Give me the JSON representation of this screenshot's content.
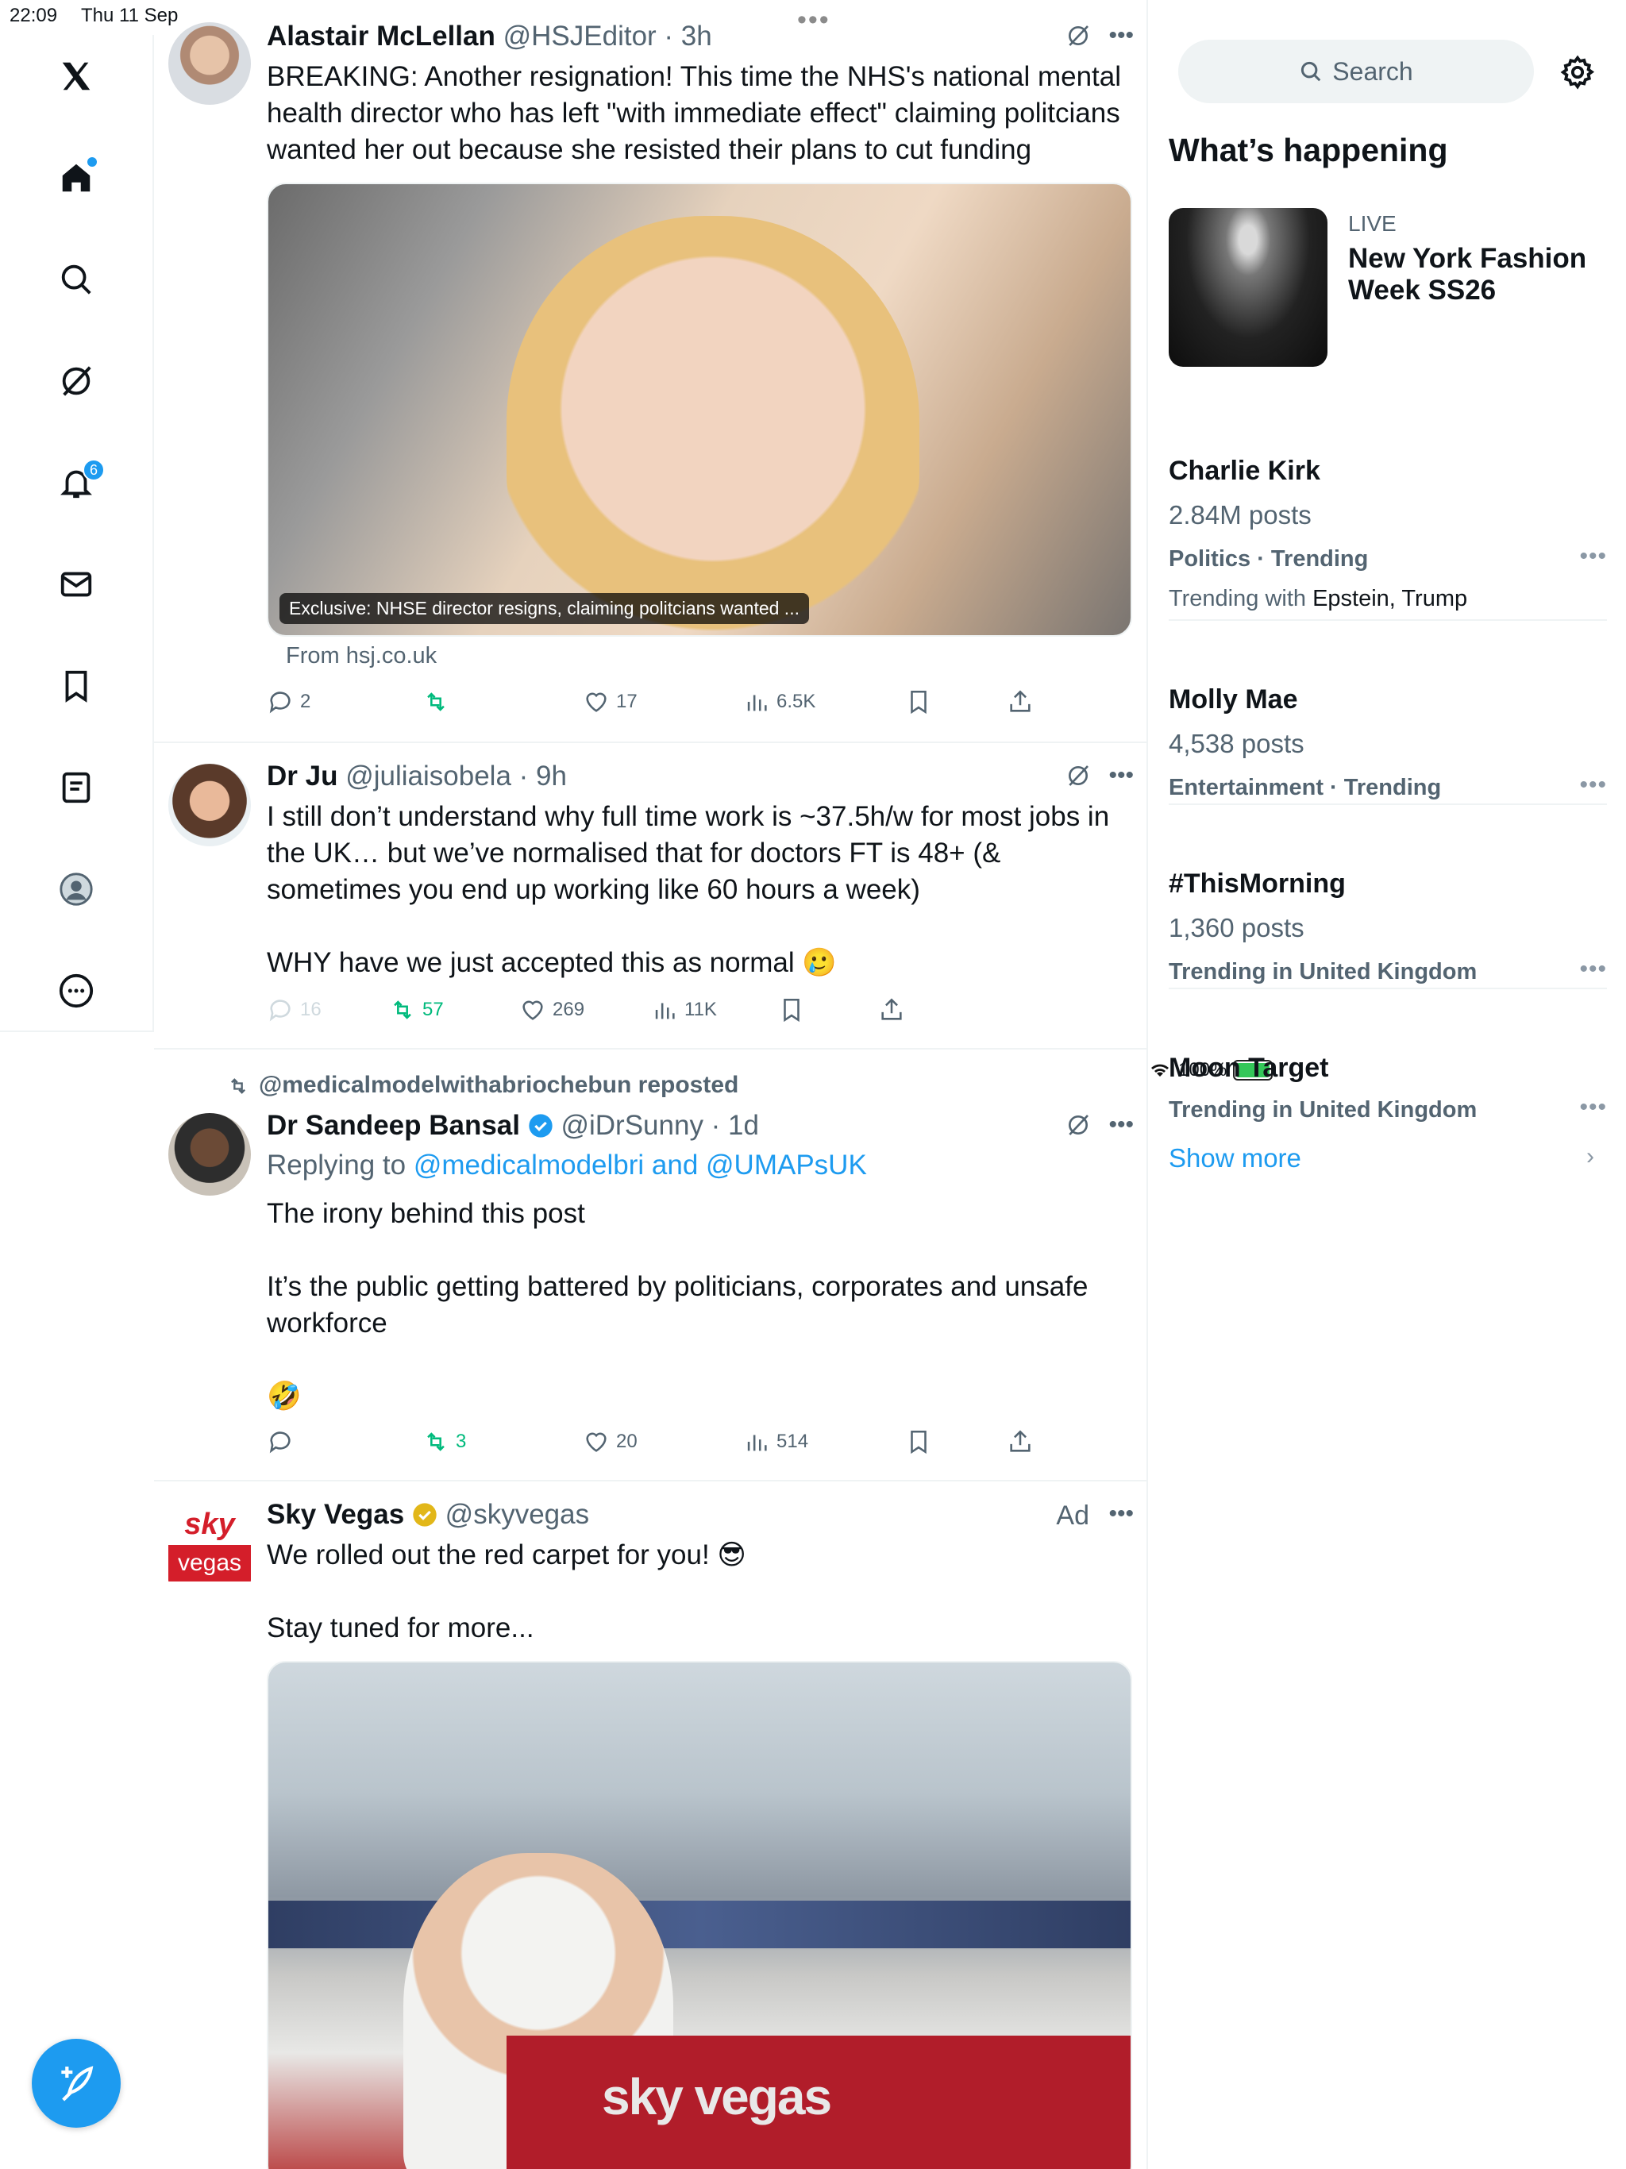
{
  "status_bar": {
    "time": "22:09",
    "date": "Thu 11 Sep",
    "battery": "100%"
  },
  "nav": {
    "items": [
      "x-logo",
      "home",
      "search",
      "grok",
      "notifications",
      "messages",
      "bookmarks",
      "lists",
      "profile",
      "more"
    ],
    "notification_count": "6"
  },
  "tweets": [
    {
      "name": "Alastair McLellan",
      "handle": "@HSJEditor · 3h",
      "text": "BREAKING: Another resignation! This time the NHS's national mental health director who has left \"with immediate effect\" claiming politcians wanted her out because she resisted their plans to cut funding",
      "media_caption": "Exclusive: NHSE director resigns, claiming politcians wanted ...",
      "from": "From hsj.co.uk",
      "replies": "2",
      "reposts": "",
      "likes": "17",
      "views": "6.5K"
    },
    {
      "name": "Dr Ju",
      "handle": "@juliaisobela · 9h",
      "text": "I still don’t understand why full time work is ~37.5h/w for most jobs in the UK… but we’ve normalised that for doctors FT is 48+ (& sometimes you end up working like 60 hours a week)\n\nWHY have we just accepted this as normal 🥲",
      "replies": "16",
      "reposts": "57",
      "likes": "269",
      "views": "11K"
    },
    {
      "repost_by": "@medicalmodelwithabriochebun reposted",
      "name": "Dr Sandeep Bansal",
      "handle": "@iDrSunny · 1d",
      "replying_prefix": "Replying to ",
      "replying_to": "@medicalmodelbri and @UMAPsUK",
      "text": "The irony behind this post\n\nIt’s the public getting battered by politicians, corporates and unsafe workforce\n\n🤣",
      "replies": "",
      "reposts": "3",
      "likes": "20",
      "views": "514"
    },
    {
      "name": "Sky Vegas",
      "handle": "@skyvegas",
      "ad": "Ad",
      "text": "We rolled out the red carpet for you! 😎\n\nStay tuned for more...",
      "logo_top": "sky",
      "logo_bottom": "vegas",
      "media_brand": "sky vegas"
    }
  ],
  "right": {
    "search_placeholder": "Search",
    "section_title": "What’s happening",
    "event": {
      "live": "LIVE",
      "title": "New York Fashion Week SS26"
    },
    "trends": [
      {
        "name": "Charlie Kirk",
        "posts": "2.84M posts",
        "category": "Politics · Trending",
        "with_prefix": "Trending with ",
        "with": "Epstein, Trump"
      },
      {
        "name": "Molly Mae",
        "posts": "4,538 posts",
        "category": "Entertainment · Trending"
      },
      {
        "name": "#ThisMorning",
        "posts": "1,360 posts",
        "category": "Trending in United Kingdom"
      },
      {
        "name": "Moon Target",
        "category": "Trending in United Kingdom"
      }
    ],
    "show_more": "Show more"
  },
  "colors": {
    "accent": "#1d9bf0",
    "repost_green": "#00ba7c",
    "muted": "#536471",
    "divider": "#eff3f4"
  }
}
